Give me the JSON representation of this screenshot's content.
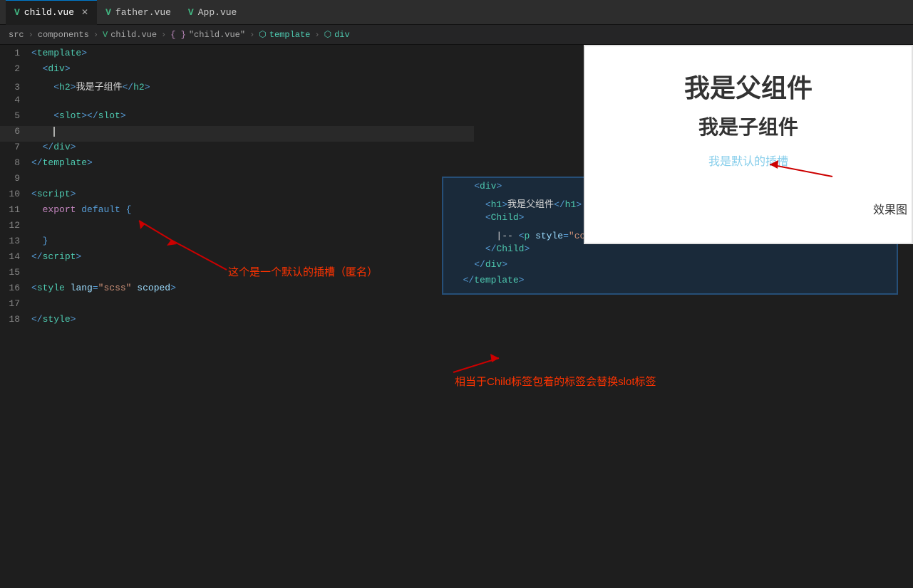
{
  "tabs": [
    {
      "id": "child",
      "label": "child.vue",
      "active": true,
      "closable": true
    },
    {
      "id": "father",
      "label": "father.vue",
      "active": false,
      "closable": false
    },
    {
      "id": "app",
      "label": "App.vue",
      "active": false,
      "closable": false
    }
  ],
  "breadcrumb": {
    "parts": [
      "src",
      ">",
      "components",
      ">",
      "child.vue",
      ">",
      "{ } \"child.vue\"",
      ">",
      "template",
      ">",
      "div"
    ]
  },
  "child_code": {
    "lines": [
      {
        "num": 1,
        "html": "<span class='tag'>&lt;</span><span class='tag-name'>template</span><span class='tag'>&gt;</span>"
      },
      {
        "num": 2,
        "html": "  <span class='tag'>&lt;</span><span class='tag-name'>div</span><span class='tag'>&gt;</span>"
      },
      {
        "num": 3,
        "html": "    <span class='tag'>&lt;</span><span class='tag-name'>h2</span><span class='tag'>&gt;</span><span class='text-content'>我是子组件</span><span class='tag'>&lt;/</span><span class='tag-name'>h2</span><span class='tag'>&gt;</span>"
      },
      {
        "num": 4,
        "html": ""
      },
      {
        "num": 5,
        "html": "    <span class='tag'>&lt;</span><span class='tag-name'>slot</span><span class='tag'>&gt;&lt;/</span><span class='tag-name'>slot</span><span class='tag'>&gt;</span>"
      },
      {
        "num": 6,
        "html": "    ",
        "cursor": true
      },
      {
        "num": 7,
        "html": "  <span class='tag'>&lt;/</span><span class='tag-name'>div</span><span class='tag'>&gt;</span>"
      },
      {
        "num": 8,
        "html": "<span class='tag'>&lt;/</span><span class='tag-name'>template</span><span class='tag'>&gt;</span>"
      },
      {
        "num": 9,
        "html": ""
      },
      {
        "num": 10,
        "html": "<span class='tag'>&lt;</span><span class='tag-name'>script</span><span class='tag'>&gt;</span>"
      },
      {
        "num": 11,
        "html": "  <span class='export-kw'>export</span> <span class='default-kw'>default</span> <span class='tag'>{</span>"
      },
      {
        "num": 12,
        "html": ""
      },
      {
        "num": 13,
        "html": "  <span class='tag'>}</span>"
      },
      {
        "num": 14,
        "html": "<span class='tag'>&lt;/</span><span class='tag-name'>script</span><span class='tag'>&gt;</span>"
      },
      {
        "num": 15,
        "html": ""
      },
      {
        "num": 16,
        "html": "<span class='tag'>&lt;</span><span class='tag-name'>style</span> <span class='attr-name'>lang</span><span class='tag'>=</span><span class='attr-val'>\"scss\"</span> <span class='attr-name'>scoped</span><span class='tag'>&gt;</span>"
      },
      {
        "num": 17,
        "html": ""
      },
      {
        "num": 18,
        "html": "<span class='tag'>&lt;/</span><span class='tag-name'>style</span><span class='tag'>&gt;</span>"
      }
    ]
  },
  "father_code": {
    "lines": [
      {
        "num": null,
        "html": "    <span class='tag'>&lt;</span><span class='tag-name'>div</span><span class='tag'>&gt;</span>"
      },
      {
        "num": null,
        "html": "      <span class='tag'>&lt;</span><span class='tag-name'>h1</span><span class='tag'>&gt;</span><span class='text-content'>我是父组件</span><span class='tag'>&lt;/</span><span class='tag-name'>h1</span><span class='tag'>&gt;</span>"
      },
      {
        "num": null,
        "html": "      <span class='tag'>&lt;</span><span class='tag-name'>Child</span><span class='tag'>&gt;</span>"
      },
      {
        "num": null,
        "html": "        <span class='tag'>|--</span> <span class='tag'>&lt;</span><span class='tag-name'>p</span> <span class='attr-name'>style</span><span class='tag'>=</span><span class='attr-val'>\"color:skyblue;\"</span><span class='tag'>&gt;</span><span class='text-content'>我是默认的插槽</span><span class='tag'>&lt;/</span><span class='tag-name'>p</span><span class='tag'>&gt;</span>"
      },
      {
        "num": null,
        "html": "      <span class='tag'>&lt;/</span><span class='tag-name'>Child</span><span class='tag'>&gt;</span>"
      },
      {
        "num": null,
        "html": "    <span class='tag'>&lt;/</span><span class='tag-name'>div</span><span class='tag'>&gt;</span>"
      },
      {
        "num": null,
        "html": "  <span class='tag'>&lt;/</span><span class='tag-name'>template</span><span class='tag'>&gt;</span>"
      }
    ]
  },
  "preview": {
    "father_title": "我是父组件",
    "child_title": "我是子组件",
    "slot_text": "我是默认的插槽",
    "effect_label": "效果图"
  },
  "annotations": {
    "default_slot_label": "这个是一个默认的插槽（匿名）",
    "replace_slot_label": "相当于Child标签包着的标签会替换slot标签"
  },
  "colors": {
    "arrow": "#cc0000",
    "annotation_text": "#ff4444",
    "preview_bg": "#ffffff",
    "editor_bg": "#1e1e1e",
    "father_panel_bg": "#1a2a3a",
    "father_panel_border": "#264f78"
  }
}
